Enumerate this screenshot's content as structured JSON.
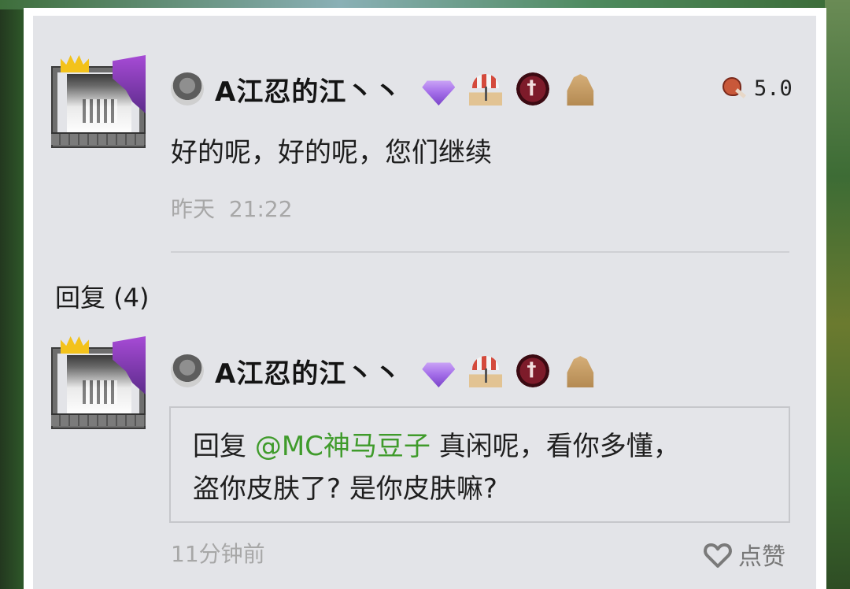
{
  "comment": {
    "username": "A江忍的江丶丶",
    "text": "好的呢，好的呢，您们继续",
    "time_day": "昨天",
    "time_clock": "21:22",
    "score": "5.0"
  },
  "replies": {
    "title": "回复 (4)",
    "items": [
      {
        "username": "A江忍的江丶丶",
        "prefix": "回复",
        "mention": "@MC神马豆子",
        "line1_rest": "真闲呢，看你多懂，",
        "line2": "盗你皮肤了? 是你皮肤嘛?",
        "time": "11分钟前",
        "like_label": "点赞"
      }
    ]
  },
  "colors": {
    "mention": "#3f9b2b",
    "timestamp": "#a7a7a7"
  },
  "icons": [
    "cobblestone-icon",
    "gem-crown-icon",
    "beach-umbrella-icon",
    "red-seal-icon",
    "helmet-icon",
    "meat-icon",
    "heart-icon"
  ]
}
